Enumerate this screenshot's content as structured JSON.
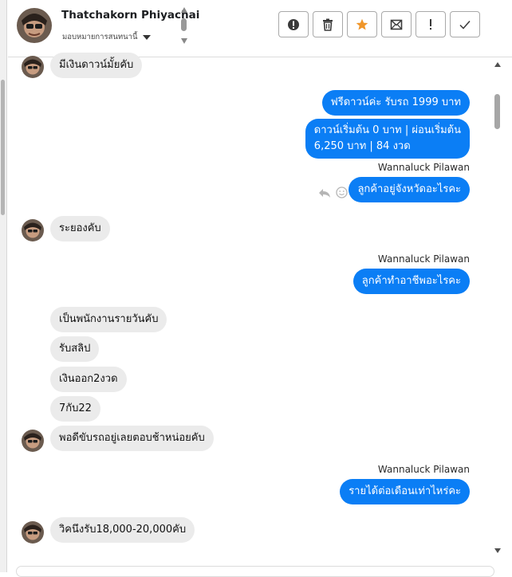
{
  "header": {
    "name": "Thatchakorn Phiyachai",
    "assign_label": "มอบหมายการสนทนานี้"
  },
  "toolbar": {
    "buttons": [
      "alert-icon",
      "trash-icon",
      "star-icon",
      "mail-icon",
      "exclamation-icon",
      "check-icon"
    ]
  },
  "messages": {
    "m1": "มีเงินดาวน์มั้ยคับ",
    "m2": "ฟรีดาวน์ค่ะ รับรถ 1999 บาท",
    "m3_line1": "ดาวน์เริ่มต้น 0 บาท | ผ่อนเริ่มต้น",
    "m3_line2": "6,250 บาท | 84 งวด",
    "sender1": "Wannaluck Pilawan",
    "m4": "ลูกค้าอยู่จังหวัดอะไรคะ",
    "m5": "ระยองคับ",
    "sender2": "Wannaluck Pilawan",
    "m6": "ลูกค้าทำอาชีพอะไรคะ",
    "m7": "เป็นพนักงานรายวันคับ",
    "m8": "รับสลิป",
    "m9": "เงินออก2งวด",
    "m10": "7กับ22",
    "m11": "พอดีขับรถอยู่เลยตอบช้าหน่อยคับ",
    "sender3": "Wannaluck Pilawan",
    "m12": "รายได้ต่อเดือนเท่าไหร่คะ",
    "m13": "วิคนึงรับ18,000-20,000คับ"
  },
  "colors": {
    "outgoing": "#0b7ef5",
    "incoming": "#ebebeb",
    "star": "#f0962a"
  }
}
